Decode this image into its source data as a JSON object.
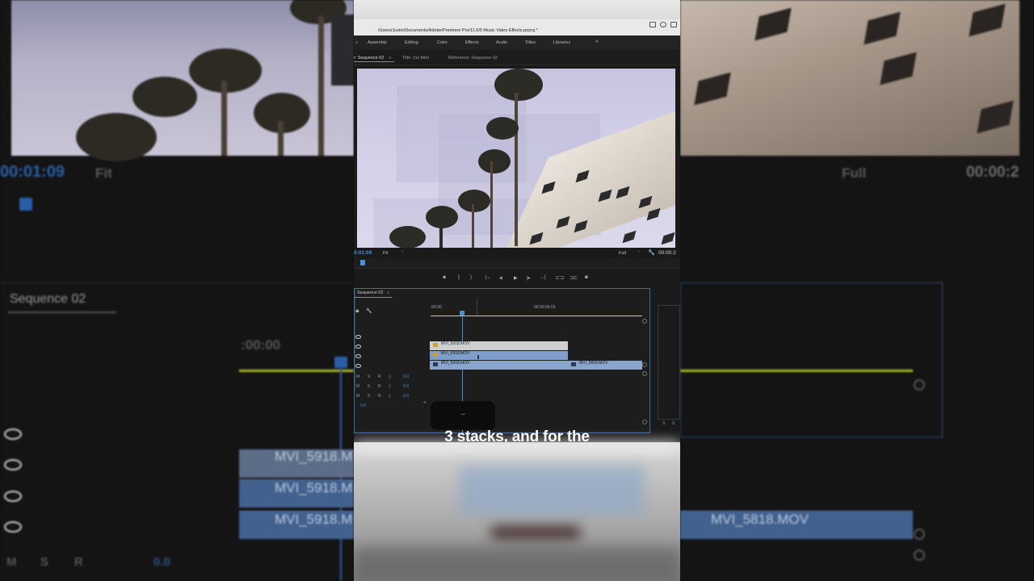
{
  "background": {
    "left_timecode": "00:01:09",
    "left_fit": "Fit",
    "right_full": "Full",
    "right_timecode": "00:00:2",
    "panel_title": "Sequence 02",
    "ruler_tc": ":00:00",
    "clips_left": [
      "MVI_5918.M",
      "MVI_5918.M",
      "MVI_5918.M"
    ],
    "clip_right": "MVI_5818.MOV",
    "msr": [
      "M",
      "S",
      "R"
    ],
    "msr_value": "0.0"
  },
  "window": {
    "path": "/Users/Justin/Documents/Adobe/Premiere Pro/11.0/5 Music Video Effects.prproj *"
  },
  "workspaces": {
    "items": [
      "Assembly",
      "Editing",
      "Color",
      "Effects",
      "Audio",
      "Titles",
      "Libraries"
    ],
    "more": "»",
    "menu": "≡"
  },
  "tabs": {
    "program": "r: Sequence 02",
    "program_menu": "≡",
    "title": "Title: (no title)",
    "reference": "Reference: Sequence 02"
  },
  "monitor": {
    "timecode": "0:01:09",
    "fit": "Fit",
    "full": "Full",
    "timecode_right": "00:00:2",
    "dropdown": "⌄"
  },
  "transport": {
    "marker": "⬥",
    "in": "{",
    "out": "}",
    "go_in": "|←",
    "step_back": "◂|",
    "play": "▶",
    "step_fwd": "|▸",
    "go_out": "→|",
    "lift": "⊏⊐",
    "extract": "⊐⊏",
    "camera": "◙"
  },
  "timeline": {
    "title": "Sequence 02",
    "menu": "≡",
    "tc_start": ":00:00",
    "tc_mid": "00:00:04:23",
    "clips": {
      "v3": "MVI_5918.MOV",
      "v2": "MVI_5918.MOV",
      "v1": "MVI_5918.MOV",
      "v1b": "MVI_5818.MOV"
    },
    "audio_rows": [
      {
        "m": "M",
        "s": "S",
        "r": "R",
        "val": "0.0"
      },
      {
        "m": "M",
        "s": "S",
        "r": "R",
        "val": "0.0"
      },
      {
        "m": "M",
        "s": "S",
        "r": "R",
        "val": "0.0"
      }
    ],
    "master_val": "0.0",
    "meter_labels": [
      "S",
      "S"
    ]
  },
  "caption": {
    "text": "3 stacks, and for the"
  },
  "colors": {
    "accent_blue": "#4a8fd6",
    "clip_blue": "#7f9ec8",
    "playline_yellow": "#d8d840",
    "fx_badge": "#c9a52a"
  }
}
